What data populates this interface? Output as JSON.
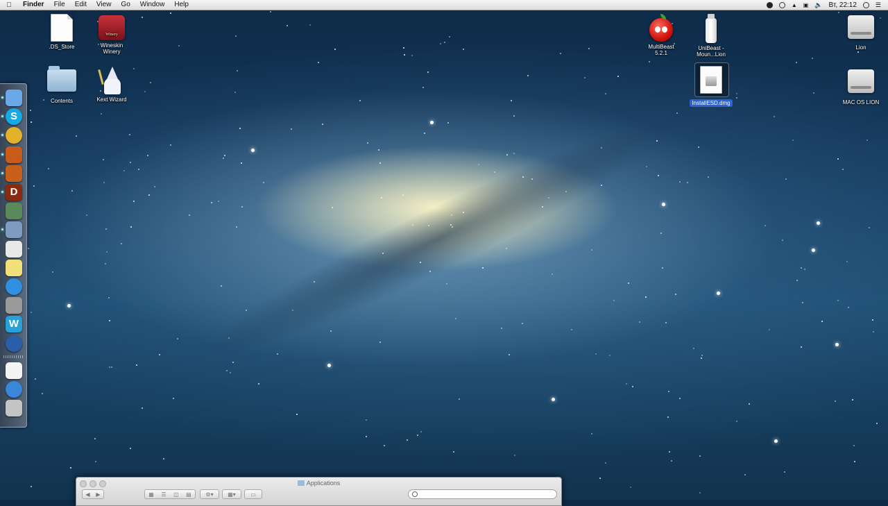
{
  "menubar": {
    "apple_icon": "apple-logo",
    "items": [
      "Finder",
      "File",
      "Edit",
      "View",
      "Go",
      "Window",
      "Help"
    ],
    "clock": "Вт, 22:12",
    "tray_icons": [
      "shield-check-icon",
      "time-machine-icon",
      "eject-icon",
      "airplay-icon",
      "volume-icon",
      "spotlight-icon",
      "list-icon"
    ]
  },
  "desktop": {
    "icons": [
      {
        "label": ".DS_Store",
        "type": "document"
      },
      {
        "label": "Wineskin Winery",
        "type": "app",
        "badge": "Winery"
      },
      {
        "label": "Contents",
        "type": "folder"
      },
      {
        "label": "Kext Wizard",
        "type": "app"
      },
      {
        "label": "MultiBeast 5.2.1",
        "type": "app"
      },
      {
        "label": "UniBeast - Moun...Lion",
        "type": "app"
      },
      {
        "label": "InstallESD.dmg",
        "type": "disk-image",
        "selected": true
      },
      {
        "label": "Lion",
        "type": "hard-drive"
      },
      {
        "label": "MAC OS LION",
        "type": "hard-drive"
      }
    ]
  },
  "dock": {
    "items": [
      {
        "name": "finder",
        "color": "#6aa8e8"
      },
      {
        "name": "skype",
        "color": "#17a9e3",
        "glyph": "S"
      },
      {
        "name": "chrome",
        "color": "#e2b32a"
      },
      {
        "name": "game-1",
        "color": "#c85a1a"
      },
      {
        "name": "game-2",
        "color": "#c8601a"
      },
      {
        "name": "diablo",
        "color": "#8a2b10",
        "glyph": "D"
      },
      {
        "name": "utility",
        "color": "#5a8a5a"
      },
      {
        "name": "preview",
        "color": "#7d9cc0"
      },
      {
        "name": "textedit",
        "color": "#e8e8e8"
      },
      {
        "name": "stickies",
        "color": "#f2e07a"
      },
      {
        "name": "app-store",
        "color": "#2f8fe0"
      },
      {
        "name": "system-preferences",
        "color": "#9a9a9a"
      },
      {
        "name": "wineskin",
        "color": "#2aa0d8",
        "glyph": "W"
      },
      {
        "name": "network",
        "color": "#2a5ea8"
      },
      {
        "name": "document",
        "color": "#f4f4f4"
      },
      {
        "name": "applications-stack",
        "color": "#3a86d8"
      },
      {
        "name": "trash",
        "color": "#c4c4c4"
      }
    ]
  },
  "finder_window": {
    "title": "Applications",
    "search_placeholder": ""
  }
}
